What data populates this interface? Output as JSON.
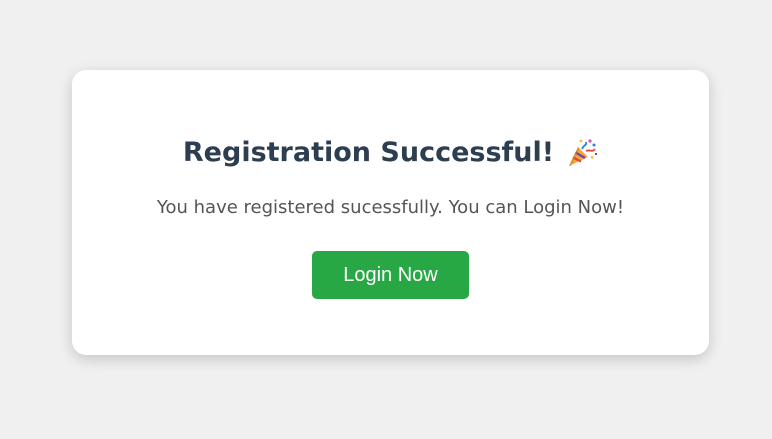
{
  "card": {
    "title": "Registration Successful!",
    "title_icon": "party-popper-icon",
    "message": "You have registered sucessfully. You can Login Now!",
    "login_button_label": "Login Now"
  },
  "colors": {
    "background": "#f0f0f0",
    "card_background": "#ffffff",
    "title_text": "#2c3e50",
    "message_text": "#555555",
    "button_background": "#28a745",
    "button_text": "#ffffff"
  }
}
